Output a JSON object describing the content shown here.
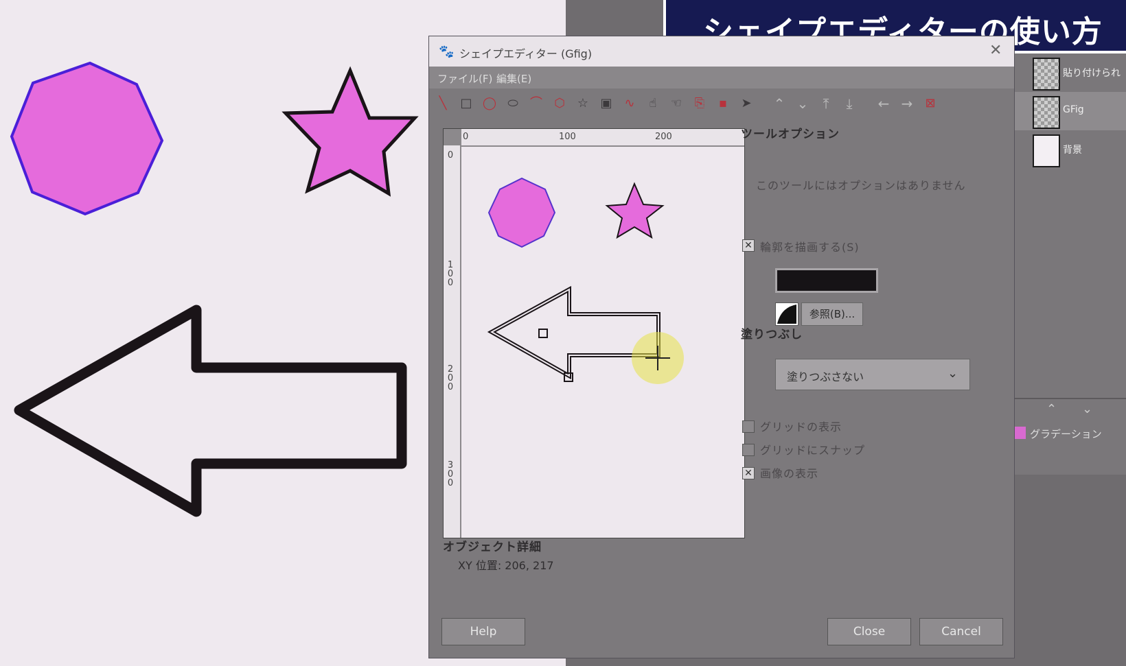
{
  "banner": {
    "title": "シェイプエディターの使い方"
  },
  "dialog": {
    "title": "シェイプエディター (Gfig)",
    "menu": {
      "file": "ファイル(F)",
      "edit": "編集(E)"
    },
    "ruler": {
      "top_labels": [
        "0",
        "100",
        "200"
      ],
      "left_labels": [
        "0",
        "100",
        "200",
        "300"
      ]
    },
    "tool_options": {
      "title": "ツールオプション",
      "no_options": "このツールにはオプションはありません",
      "stroke_label": "輪郭を描画する(S)",
      "stroke_checked": true,
      "stroke_color": "#161316",
      "browse_label": "参照(B)...",
      "fill_title": "塗りつぶし",
      "fill_value": "塗りつぶさない",
      "show_grid": "グリッドの表示",
      "show_grid_checked": false,
      "snap_grid": "グリッドにスナップ",
      "snap_grid_checked": false,
      "show_image": "画像の表示",
      "show_image_checked": true
    },
    "object_details": {
      "title": "オブジェクト詳細",
      "xy": "XY 位置:  206, 217"
    },
    "buttons": {
      "help": "Help",
      "close": "Close",
      "cancel": "Cancel"
    }
  },
  "layers": [
    {
      "name": "貼り付けられ",
      "thumb": "checker"
    },
    {
      "name": "GFig",
      "thumb": "checker",
      "selected": true
    },
    {
      "name": "背景",
      "thumb": "white"
    }
  ],
  "lower_panel": {
    "gradient_label": "グラデーション"
  },
  "colors": {
    "shape_fill": "#e56bdc",
    "octagon_outline": "#4a1fd8",
    "outline": "#1a1418",
    "banner_bg": "#161a52"
  },
  "toolbar_icons": [
    "line-icon",
    "rectangle-icon",
    "circle-icon",
    "ellipse-icon",
    "arc-icon",
    "polygon-icon",
    "star-icon",
    "spiral-icon",
    "bezier-icon",
    "move-object-icon",
    "move-point-icon",
    "copy-icon",
    "delete-icon",
    "select-icon",
    "raise-icon",
    "lower-icon",
    "top-icon",
    "bottom-icon",
    "back-icon",
    "forward-icon",
    "show-all-icon"
  ]
}
